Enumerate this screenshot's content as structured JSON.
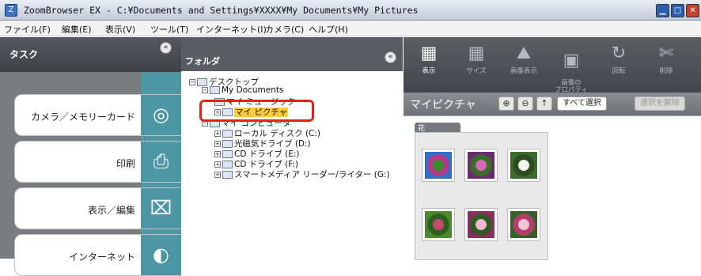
{
  "title": {
    "text": "ZoomBrowser EX  -  C:¥Documents and Settings¥XXXX¥My Documents¥My Pictures"
  },
  "menu": [
    "ファイル(F)",
    "編集(E)",
    "表示(V)",
    "ツール(T)",
    "インターネット(I)",
    "カメラ(C)",
    "ヘルプ(H)"
  ],
  "task_pane": {
    "title": "タスク",
    "collapse_glyph": "«",
    "buttons": [
      {
        "label": "カメラ／メモリーカード",
        "icon": "camera-icon",
        "glyph": "◎"
      },
      {
        "label": "印刷",
        "icon": "printer-icon",
        "glyph": "⎙"
      },
      {
        "label": "表示／編集",
        "icon": "image-edit-icon",
        "glyph": "⌧"
      },
      {
        "label": "インターネット",
        "icon": "globe-icon",
        "glyph": "◐"
      }
    ]
  },
  "folder_pane": {
    "title": "フォルダ",
    "collapse_glyph": "«",
    "tree": [
      {
        "label": "デスクトップ"
      },
      {
        "label": "My Documents"
      },
      {
        "label": "マイ ミュージック"
      },
      {
        "label": "マイ ピクチャ",
        "selected": true
      },
      {
        "label": "マイ コンピュータ"
      },
      {
        "label": "ローカル ディスク (C:)"
      },
      {
        "label": "光磁気ドライブ (D:)"
      },
      {
        "label": "CD ドライブ (E:)"
      },
      {
        "label": "CD ドライブ (F:)"
      },
      {
        "label": "スマートメディア リーダー/ライター (G:)"
      }
    ]
  },
  "toolbar": [
    {
      "label": "表示",
      "icon": "view-mode-icon",
      "glyph": "▦",
      "active": true
    },
    {
      "label": "サイズ",
      "icon": "thumbnail-size-icon",
      "glyph": "▦"
    },
    {
      "label": "画像表示",
      "icon": "image-view-icon",
      "glyph": "⛰"
    },
    {
      "label": "画像の\nプロパティ",
      "icon": "image-properties-icon",
      "glyph": "▣"
    },
    {
      "label": "回転",
      "icon": "rotate-icon",
      "glyph": "↻"
    },
    {
      "label": "削除",
      "icon": "delete-icon",
      "glyph": "✄"
    }
  ],
  "viewbar": {
    "folder_name": "マイピクチャ",
    "zoom_in": "⊕",
    "zoom_out": "⊖",
    "up": "↑",
    "select_all": "すべて選択",
    "deselect": "選択を解除"
  },
  "group": {
    "label": "花",
    "thumbnails": [
      {
        "name": "flower-1",
        "colors": [
          "#2f6fc8",
          "#3a8d2f",
          "#b23a86"
        ]
      },
      {
        "name": "flower-2",
        "colors": [
          "#6b2a6e",
          "#d46bb2",
          "#3b6d2b"
        ]
      },
      {
        "name": "flower-3",
        "colors": [
          "#3d6b2a",
          "#f4f4f4",
          "#2a4d1f"
        ]
      },
      {
        "name": "flower-4",
        "colors": [
          "#4c8a2f",
          "#c44a6c",
          "#2d5f22"
        ]
      },
      {
        "name": "flower-5",
        "colors": [
          "#8a2f5f",
          "#f1b8d2",
          "#2f5a22"
        ]
      },
      {
        "name": "flower-6",
        "colors": [
          "#36602a",
          "#f3c3d6",
          "#b03f6b"
        ]
      }
    ]
  },
  "colors": {
    "accent_tab": "#4d97a5",
    "selection": "#ffcc33",
    "highlight_ring": "#e2231a"
  }
}
